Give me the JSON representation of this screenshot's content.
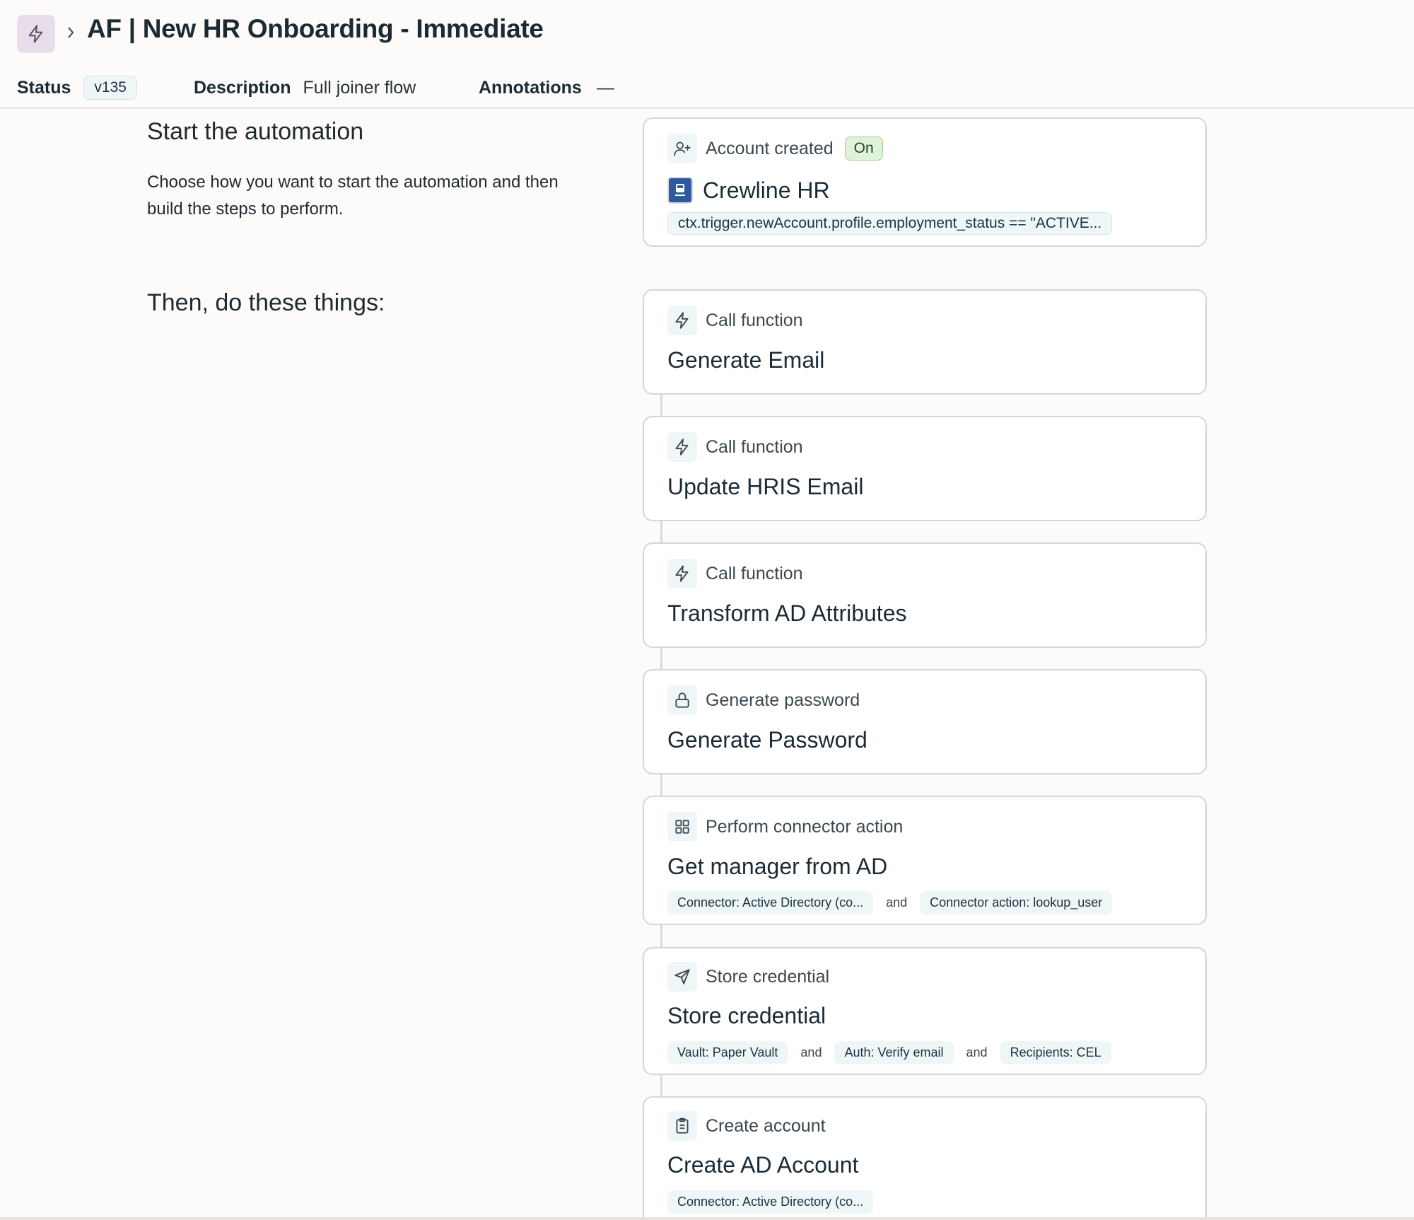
{
  "header": {
    "title": "AF | New HR Onboarding - Immediate",
    "status_label": "Status",
    "version": "v135",
    "description_label": "Description",
    "description_value": "Full joiner flow",
    "annotations_label": "Annotations",
    "annotations_value": "—"
  },
  "start": {
    "title": "Start the automation",
    "description": "Choose how you want to start the automation and then build the steps to perform."
  },
  "trigger": {
    "type": "Account created",
    "status": "On",
    "source": "Crewline HR",
    "condition": "ctx.trigger.newAccount.profile.employment_status == \"ACTIVE..."
  },
  "steps_section": {
    "title": "Then, do these things:"
  },
  "steps": [
    {
      "type": "Call function",
      "name": "Generate Email",
      "icon": "bolt-icon"
    },
    {
      "type": "Call function",
      "name": "Update HRIS Email",
      "icon": "bolt-icon"
    },
    {
      "type": "Call function",
      "name": "Transform AD Attributes",
      "icon": "bolt-icon"
    },
    {
      "type": "Generate password",
      "name": "Generate Password",
      "icon": "lock-icon"
    },
    {
      "type": "Perform connector action",
      "name": "Get manager from AD",
      "icon": "grid-icon",
      "pills": [
        "Connector: Active Directory (co...",
        "Connector action: lookup_user"
      ]
    },
    {
      "type": "Store credential",
      "name": "Store credential",
      "icon": "send-icon",
      "pills": [
        "Vault: Paper Vault",
        "Auth: Verify email",
        "Recipients: CEL"
      ]
    },
    {
      "type": "Create account",
      "name": "Create AD Account",
      "icon": "clipboard-icon",
      "pills": [
        "Connector: Active Directory (co..."
      ]
    }
  ],
  "conjunction": "and"
}
